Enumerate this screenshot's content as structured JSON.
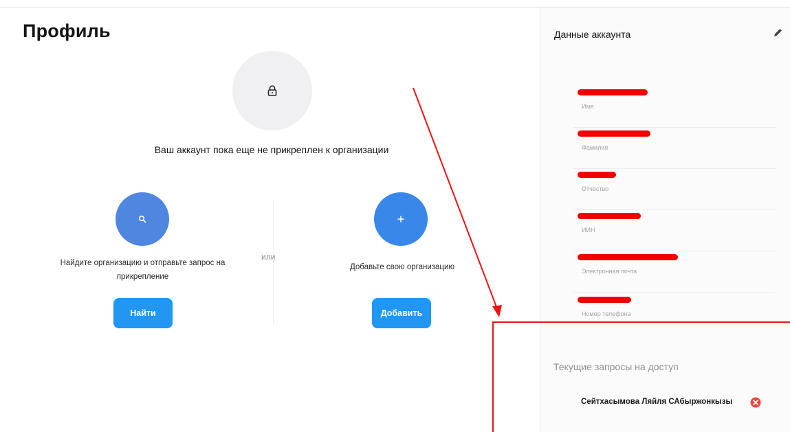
{
  "page": {
    "title": "Профиль"
  },
  "main": {
    "lock_icon": "lock-icon",
    "not_attached_message": "Ваш аккаунт пока еще не прикреплен к организации",
    "find_section": {
      "icon": "search-icon",
      "text": "Найдите организацию и отправьте запрос на прикрепление",
      "button_label": "Найти"
    },
    "or_label": "или",
    "add_section": {
      "icon": "plus-icon",
      "text": "Добавьте свою организацию",
      "button_label": "Добавить"
    }
  },
  "account": {
    "title": "Данные аккаунта",
    "edit_icon": "pencil-icon",
    "fields": [
      {
        "label": "Имя"
      },
      {
        "label": "Фамилия"
      },
      {
        "label": "Отчество"
      },
      {
        "label": "ИИН"
      },
      {
        "label": "Электронная почта"
      },
      {
        "label": "Номер телефона"
      }
    ]
  },
  "requests": {
    "title": "Текущие запросы на доступ",
    "items": [
      {
        "name": "Сейтхасымова Ляйля САбыржонкызы",
        "remove_icon": "close-circle-icon"
      }
    ]
  },
  "colors": {
    "accent_button": "#2196f3",
    "search_circle": "#4f86e0",
    "add_circle": "#3a87ea",
    "redaction": "#f20000",
    "annotation": "#ee1111",
    "remove": "#f0453a"
  }
}
